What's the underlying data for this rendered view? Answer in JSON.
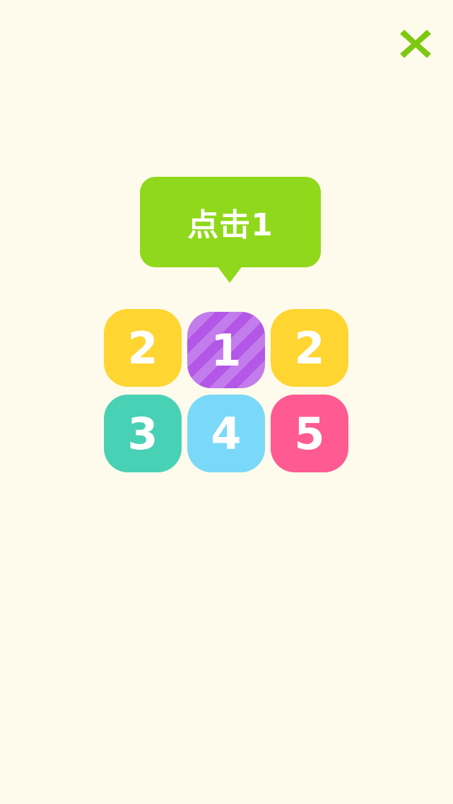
{
  "close": {
    "icon": "close-x-icon",
    "color": "#7fc812"
  },
  "prompt": {
    "text": "点击1",
    "color": "#8fd81b"
  },
  "tiles": [
    {
      "label": "2",
      "color": "#ffd531"
    },
    {
      "label": "1",
      "color": "#b257e6",
      "highlighted": true
    },
    {
      "label": "2",
      "color": "#ffd531"
    },
    {
      "label": "3",
      "color": "#48d1b5"
    },
    {
      "label": "4",
      "color": "#7ad9f8"
    },
    {
      "label": "5",
      "color": "#ff5a92"
    }
  ]
}
